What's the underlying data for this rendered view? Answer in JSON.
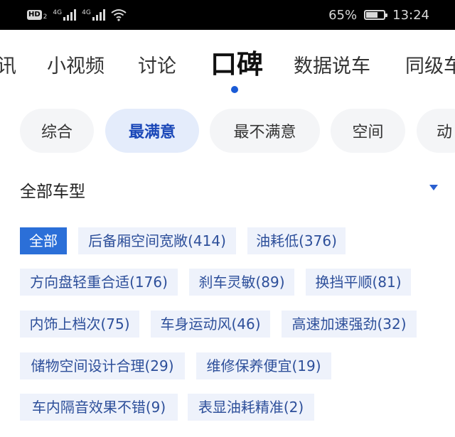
{
  "status_bar": {
    "hd": "HD",
    "sim": "2",
    "net1": "4G",
    "net2": "4G",
    "battery_percent": "65%",
    "battery_level": 0.65,
    "time": "13:24"
  },
  "tabs": [
    {
      "label": "讯"
    },
    {
      "label": "小视频"
    },
    {
      "label": "讨论"
    },
    {
      "label": "口碑"
    },
    {
      "label": "数据说车"
    },
    {
      "label": "同级车"
    }
  ],
  "filters": [
    {
      "label": "综合"
    },
    {
      "label": "最满意"
    },
    {
      "label": "最不满意"
    },
    {
      "label": "空间"
    },
    {
      "label": "动"
    }
  ],
  "model_selector": {
    "label": "全部车型"
  },
  "tags": [
    {
      "label": "全部"
    },
    {
      "label": "后备厢空间宽敞(414)"
    },
    {
      "label": "油耗低(376)"
    },
    {
      "label": "方向盘轻重合适(176)"
    },
    {
      "label": "刹车灵敏(89)"
    },
    {
      "label": "换挡平顺(81)"
    },
    {
      "label": "内饰上档次(75)"
    },
    {
      "label": "车身运动风(46)"
    },
    {
      "label": "高速加速强劲(32)"
    },
    {
      "label": "储物空间设计合理(29)"
    },
    {
      "label": "维修保养便宜(19)"
    },
    {
      "label": "车内隔音效果不错(9)"
    },
    {
      "label": "表显油耗精准(2)"
    }
  ]
}
